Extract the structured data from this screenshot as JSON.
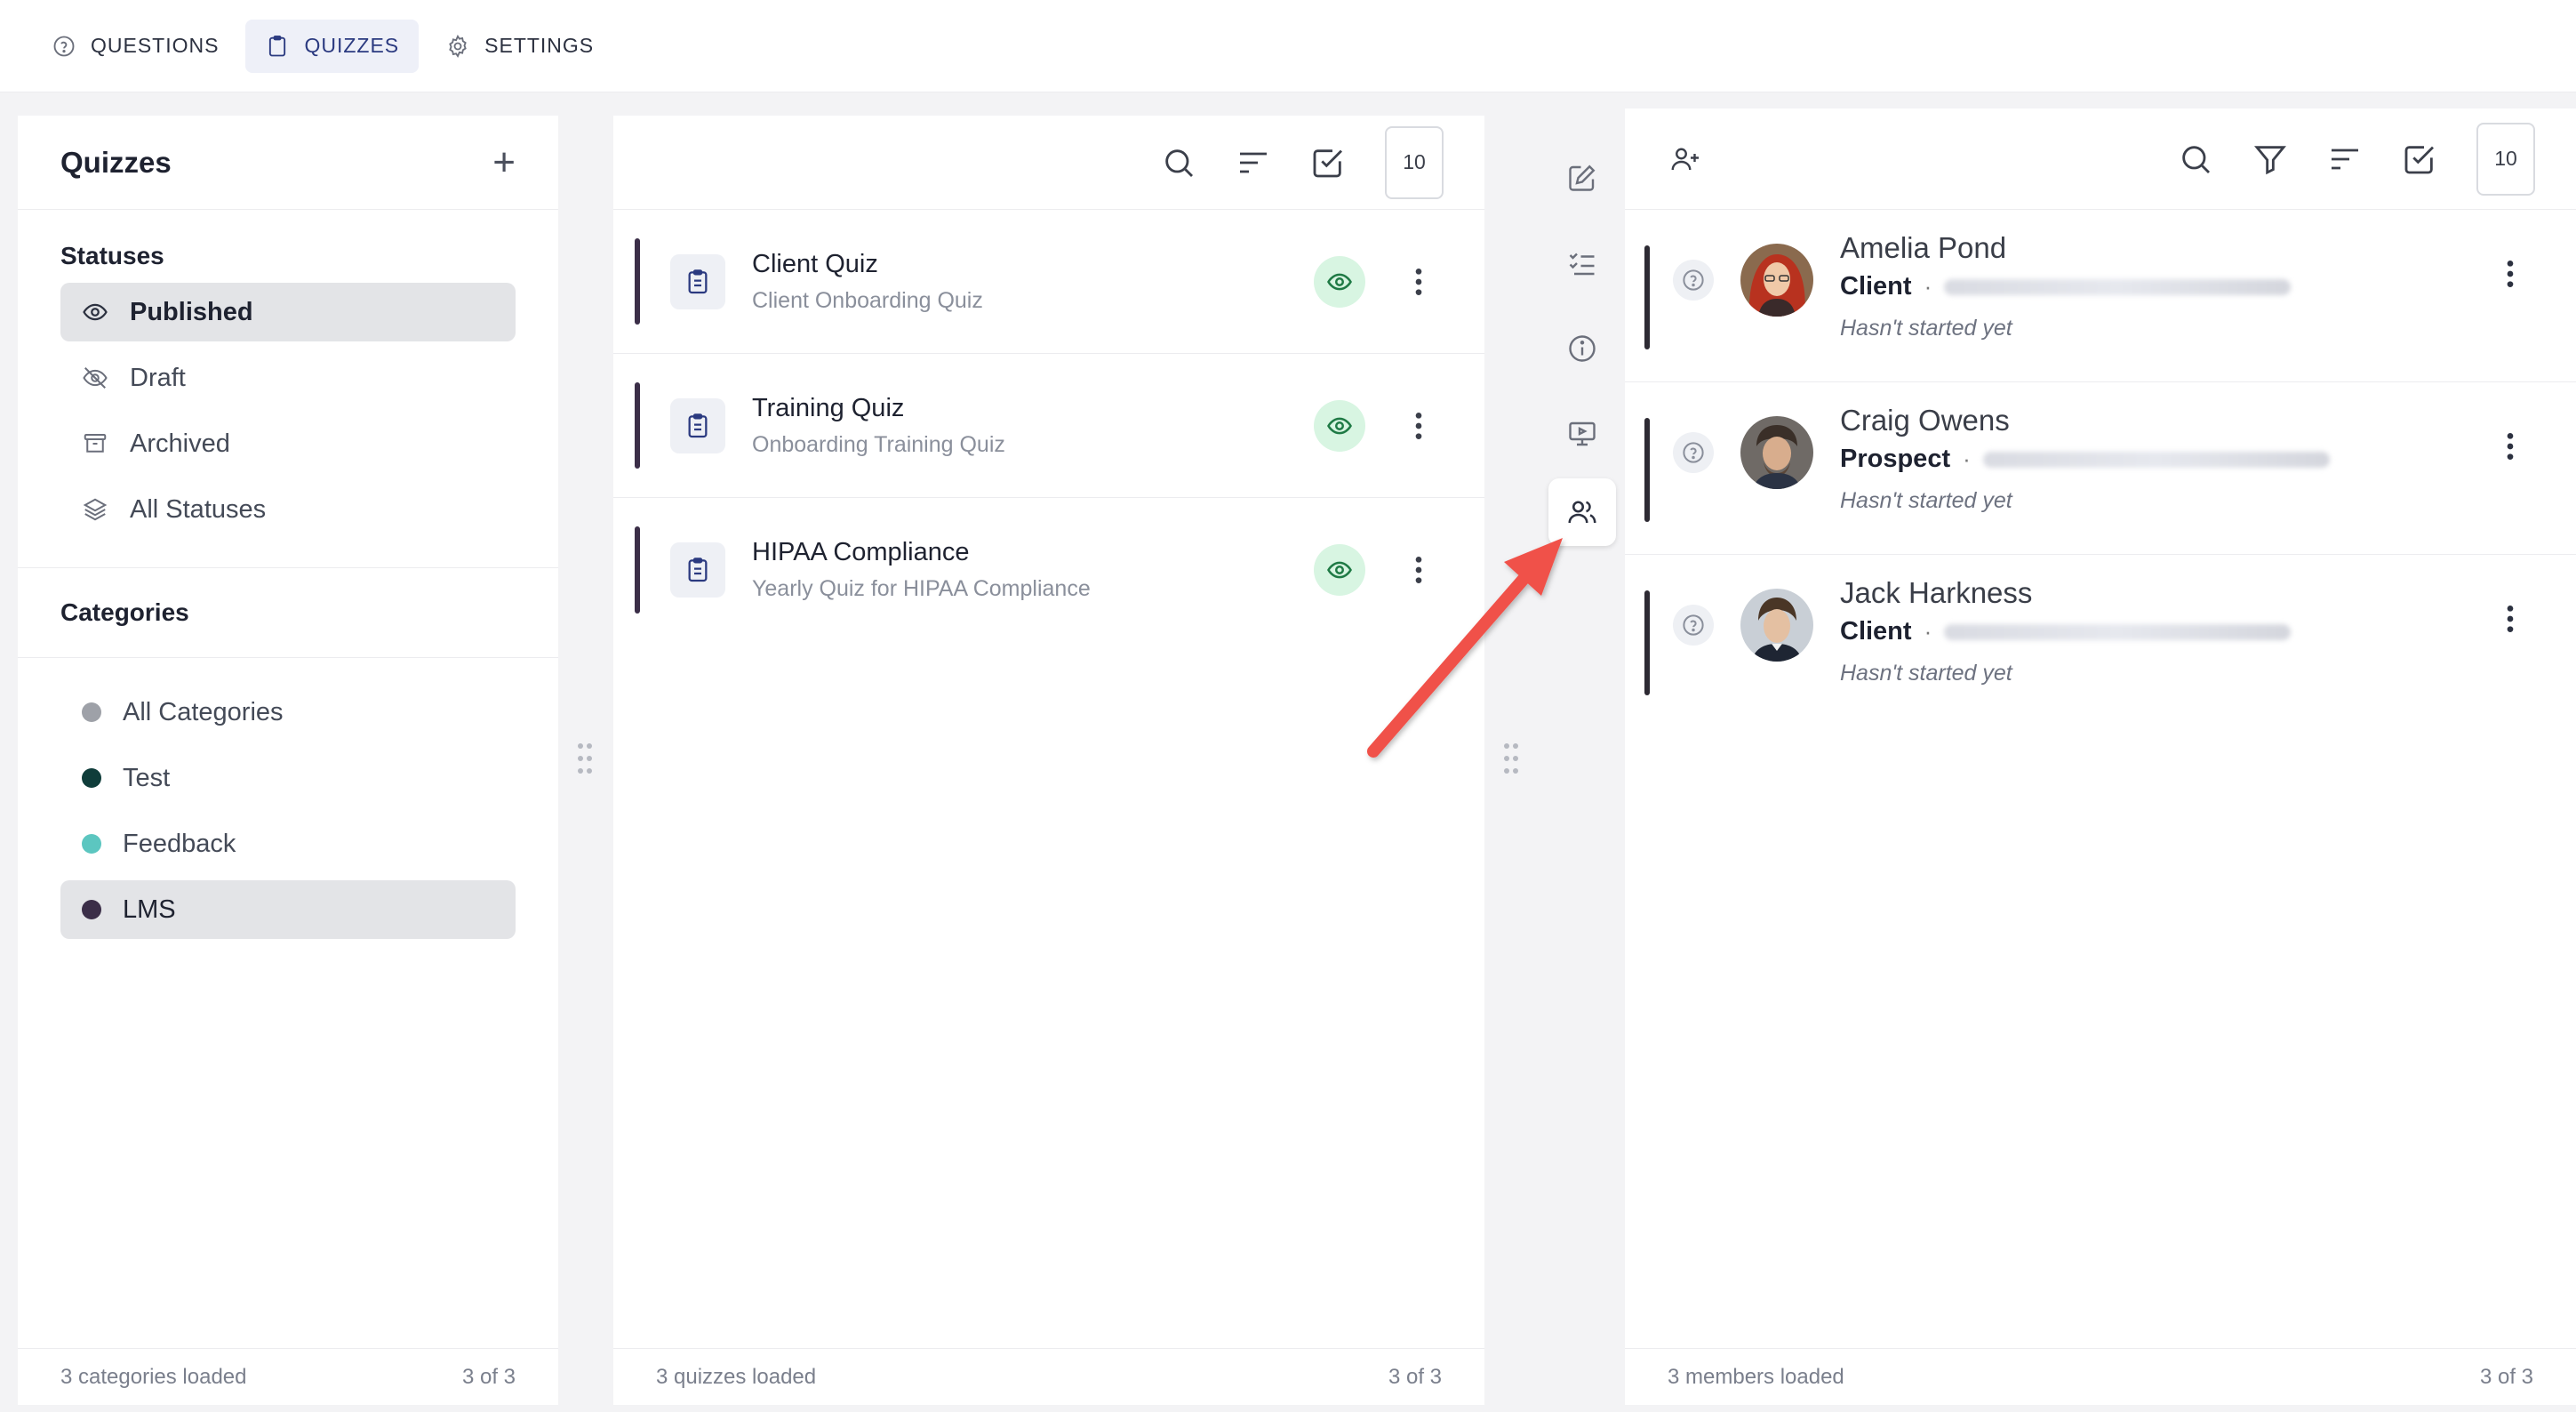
{
  "topnav": {
    "tabs": [
      {
        "label": "QUESTIONS",
        "icon": "help-circle-icon"
      },
      {
        "label": "QUIZZES",
        "icon": "clipboard-icon",
        "active": true
      },
      {
        "label": "SETTINGS",
        "icon": "gear-icon"
      }
    ]
  },
  "left": {
    "title": "Quizzes",
    "statuses_title": "Statuses",
    "statuses": [
      {
        "label": "Published",
        "icon": "eye-icon",
        "active": true
      },
      {
        "label": "Draft",
        "icon": "eye-off-icon"
      },
      {
        "label": "Archived",
        "icon": "archive-icon"
      },
      {
        "label": "All Statuses",
        "icon": "layers-icon"
      }
    ],
    "categories_title": "Categories",
    "categories": [
      {
        "label": "All Categories",
        "color": "#9ea1a8"
      },
      {
        "label": "Test",
        "color": "#0f3d3a"
      },
      {
        "label": "Feedback",
        "color": "#5cc6c0"
      },
      {
        "label": "LMS",
        "color": "#3b2e48",
        "active": true
      }
    ],
    "footer_left": "3 categories loaded",
    "footer_right": "3 of 3"
  },
  "middle": {
    "page_size": "10",
    "quizzes": [
      {
        "title": "Client Quiz",
        "subtitle": "Client Onboarding Quiz"
      },
      {
        "title": "Training Quiz",
        "subtitle": "Onboarding Training Quiz"
      },
      {
        "title": "HIPAA Compliance",
        "subtitle": "Yearly Quiz for HIPAA Compliance"
      }
    ],
    "footer_left": "3 quizzes loaded",
    "footer_right": "3 of 3"
  },
  "right": {
    "page_size": "10",
    "members": [
      {
        "name": "Amelia Pond",
        "role": "Client",
        "status": "Hasn't started yet"
      },
      {
        "name": "Craig Owens",
        "role": "Prospect",
        "status": "Hasn't started yet"
      },
      {
        "name": "Jack Harkness",
        "role": "Client",
        "status": "Hasn't started yet"
      }
    ],
    "separator": "·",
    "footer_left": "3 members loaded",
    "footer_right": "3 of 3"
  },
  "colors": {
    "accent": "#2b3a80",
    "published_badge": "#d8f5e2",
    "arrow": "#f0514a"
  }
}
